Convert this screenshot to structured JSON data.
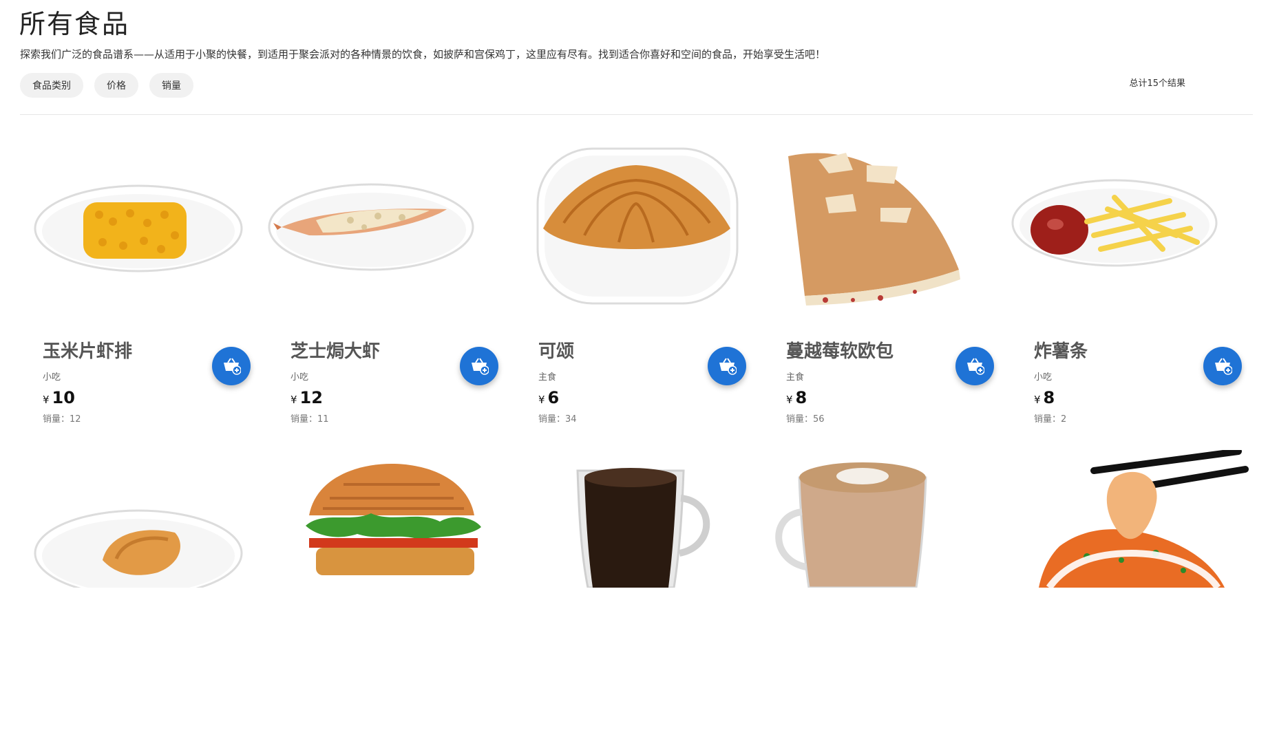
{
  "header": {
    "title": "所有食品",
    "description": "探索我们广泛的食品谱系——从适用于小聚的快餐，到适用于聚会派对的各种情景的饮食，如披萨和宫保鸡丁，这里应有尽有。找到适合你喜好和空间的食品，开始享受生活吧！",
    "filters": [
      "食品类别",
      "价格",
      "销量"
    ],
    "total": "总计15个结果"
  },
  "products": [
    {
      "name": "玉米片虾排",
      "category": "小吃",
      "currency": "¥",
      "price": "10",
      "sales": "销量：12",
      "image": "corn-shrimp-cutlet-on-plate"
    },
    {
      "name": "芝士焗大虾",
      "category": "小吃",
      "currency": "¥",
      "price": "12",
      "sales": "销量：11",
      "image": "cheese-baked-prawn-on-plate"
    },
    {
      "name": "可颂",
      "category": "主食",
      "currency": "¥",
      "price": "6",
      "sales": "销量：34",
      "image": "croissant-on-plate"
    },
    {
      "name": "蔓越莓软欧包",
      "category": "主食",
      "currency": "¥",
      "price": "8",
      "sales": "销量：56",
      "image": "cranberry-bread-wedge"
    },
    {
      "name": "炸薯条",
      "category": "小吃",
      "currency": "¥",
      "price": "8",
      "sales": "销量：2",
      "image": "fries-with-ketchup"
    }
  ],
  "second_row_images": [
    "chicken-wing-on-plate",
    "burger",
    "black-coffee-mug",
    "latte-glass-mug",
    "wontons-with-chopsticks"
  ],
  "colors": {
    "accent": "#1f73d6",
    "chip_bg": "#f1f1f1"
  },
  "icons": {
    "cart": "cart-plus-icon"
  }
}
